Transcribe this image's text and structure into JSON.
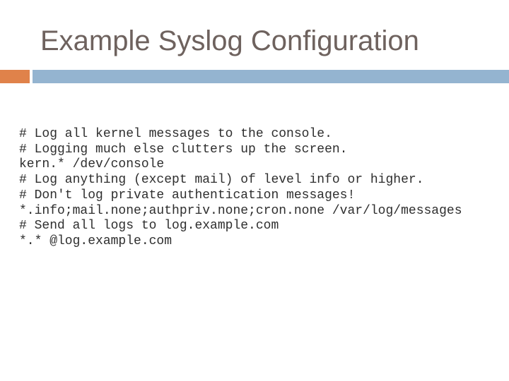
{
  "slide": {
    "title": "Example Syslog Configuration",
    "colors": {
      "title": "#6e625e",
      "accent_orange": "#e0824a",
      "accent_blue": "#94b4d0",
      "code_text": "#2e2e2e"
    },
    "code_lines": [
      "# Log all kernel messages to the console.",
      "# Logging much else clutters up the screen.",
      "kern.* /dev/console",
      "# Log anything (except mail) of level info or higher.",
      "# Don't log private authentication messages!",
      "*.info;mail.none;authpriv.none;cron.none /var/log/messages",
      "# Send all logs to log.example.com",
      "*.* @log.example.com"
    ]
  }
}
